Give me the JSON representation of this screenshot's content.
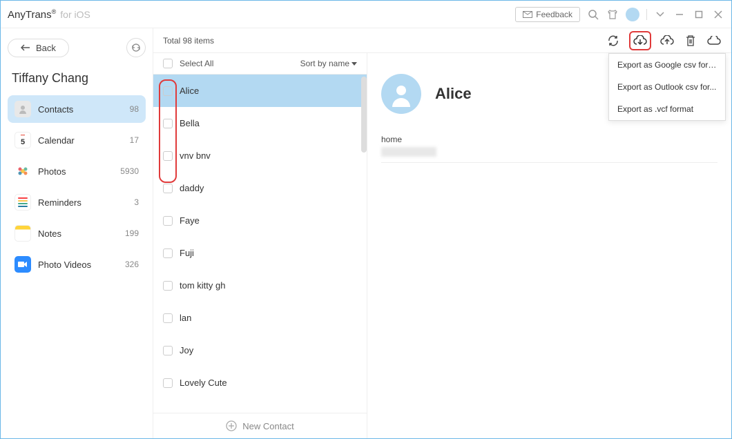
{
  "titlebar": {
    "app_name": "AnyTrans",
    "app_suffix": "for iOS",
    "feedback": "Feedback"
  },
  "sidebar": {
    "back_label": "Back",
    "user_name": "Tiffany Chang",
    "items": [
      {
        "label": "Contacts",
        "count": "98",
        "active": true,
        "icon": "contacts"
      },
      {
        "label": "Calendar",
        "count": "17",
        "active": false,
        "icon": "calendar"
      },
      {
        "label": "Photos",
        "count": "5930",
        "active": false,
        "icon": "photos"
      },
      {
        "label": "Reminders",
        "count": "3",
        "active": false,
        "icon": "reminders"
      },
      {
        "label": "Notes",
        "count": "199",
        "active": false,
        "icon": "notes"
      },
      {
        "label": "Photo Videos",
        "count": "326",
        "active": false,
        "icon": "photovideos"
      }
    ]
  },
  "toolbar": {
    "total": "Total 98 items"
  },
  "list": {
    "select_all": "Select All",
    "sort": "Sort by name",
    "contacts": [
      "Alice",
      "Bella",
      "vnv bnv",
      "daddy",
      "Faye",
      "Fuji",
      "tom kitty gh",
      "lan",
      "Joy",
      "Lovely Cute"
    ],
    "new_contact": "New Contact"
  },
  "detail": {
    "name": "Alice",
    "field_label": "home"
  },
  "dropdown": {
    "items": [
      "Export as Google csv format",
      "Export as Outlook csv for...",
      "Export as .vcf format"
    ]
  }
}
